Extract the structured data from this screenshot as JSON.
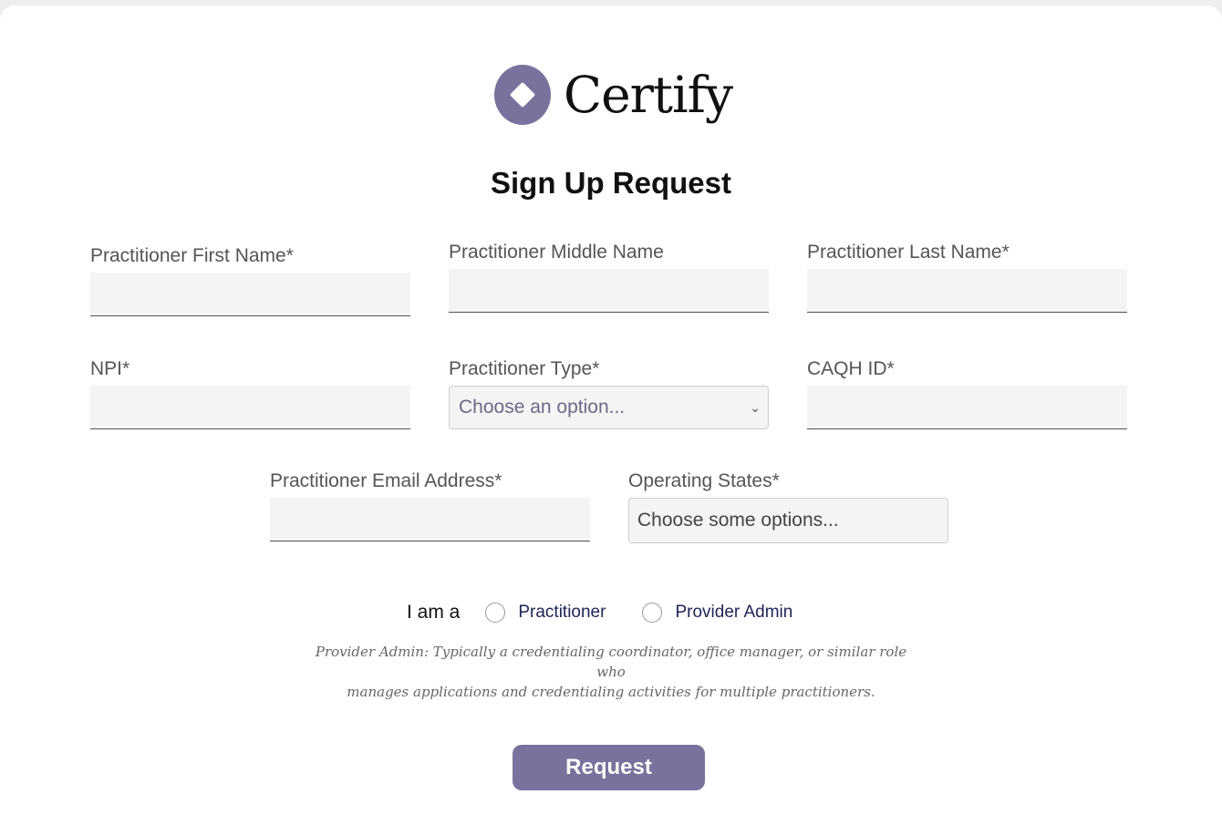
{
  "brand": {
    "name": "Certify",
    "accent": "#7a719c"
  },
  "form": {
    "title": "Sign Up Request",
    "fields": {
      "first_name": {
        "label": "Practitioner First Name*",
        "value": ""
      },
      "middle_name": {
        "label": "Practitioner Middle Name",
        "value": ""
      },
      "last_name": {
        "label": "Practitioner Last Name*",
        "value": ""
      },
      "npi": {
        "label": "NPI*",
        "value": ""
      },
      "practitioner_type": {
        "label": "Practitioner Type*",
        "selected": "Choose an option..."
      },
      "caqh_id": {
        "label": "CAQH ID*",
        "value": ""
      },
      "email": {
        "label": "Practitioner Email Address*",
        "value": ""
      },
      "operating_states": {
        "label": "Operating States*",
        "placeholder": "Choose some options..."
      }
    },
    "role": {
      "prefix": "I am a",
      "options": [
        {
          "label": "Practitioner",
          "checked": false
        },
        {
          "label": "Provider Admin",
          "checked": false
        }
      ],
      "note_line1": "Provider Admin: Typically a credentialing coordinator, office manager, or similar role who",
      "note_line2": "manages applications and credentialing activities for multiple practitioners."
    },
    "submit_label": "Request"
  }
}
